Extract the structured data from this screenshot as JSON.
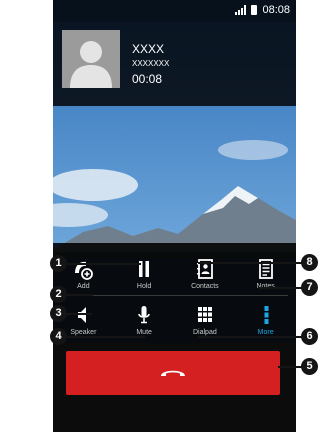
{
  "status_bar": {
    "time": "08:08"
  },
  "caller": {
    "name": "XXXX",
    "number": "XXXXXXX",
    "duration": "00:08"
  },
  "controls": {
    "add": "Add",
    "hold": "Hold",
    "contacts": "Contacts",
    "notes": "Notes",
    "speaker": "Speaker",
    "mute": "Mute",
    "dialpad": "Dialpad",
    "more": "More"
  },
  "callouts": [
    "1",
    "2",
    "3",
    "4",
    "5",
    "6",
    "7",
    "8"
  ],
  "colors": {
    "end_call": "#d42020",
    "more_accent": "#1ea7e4",
    "panel": "#000000"
  },
  "icons": {
    "add": "add-call-icon",
    "hold": "pause-icon",
    "contacts": "contacts-icon",
    "notes": "notes-icon",
    "speaker": "speaker-icon",
    "mute": "microphone-icon",
    "dialpad": "dialpad-icon",
    "more": "more-icon",
    "end_call": "end-call-icon"
  }
}
